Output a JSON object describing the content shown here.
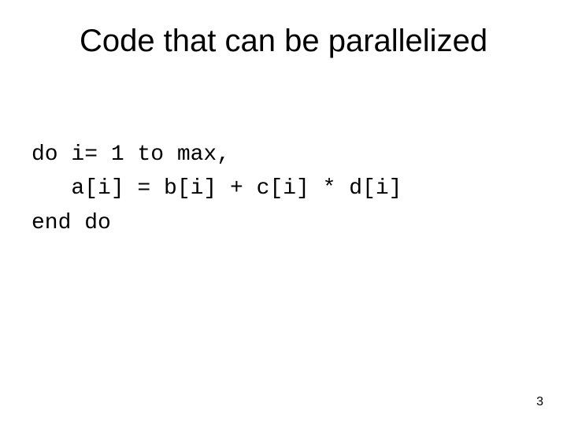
{
  "title": "Code that can be parallelized",
  "code": {
    "line1": "do i= 1 to max,",
    "line2": "   a[i] = b[i] + c[i] * d[i]",
    "line3": "end do"
  },
  "page_number": "3"
}
